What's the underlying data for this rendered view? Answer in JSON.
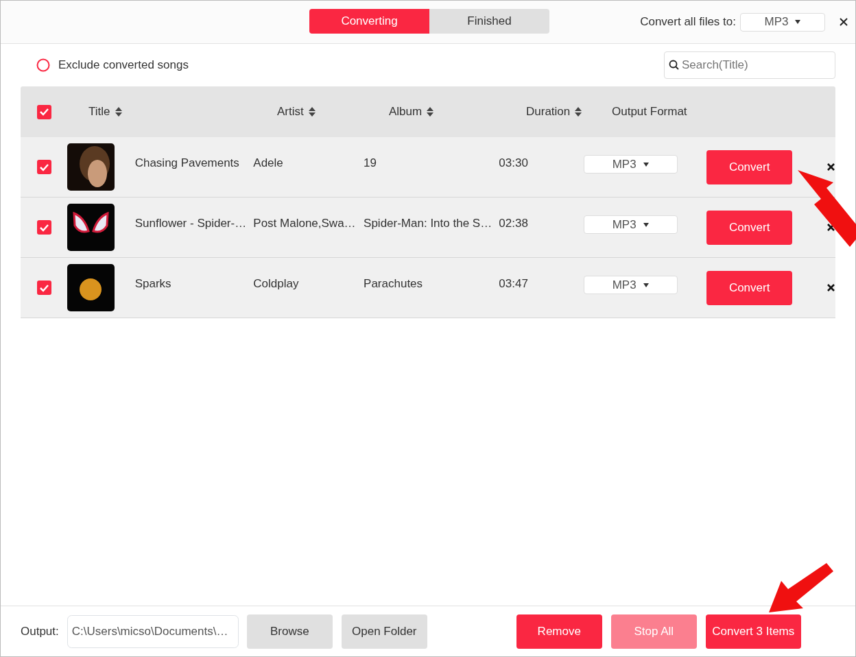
{
  "tabs": [
    {
      "label": "Converting",
      "selected": true
    },
    {
      "label": "Finished",
      "selected": false
    }
  ],
  "convert_all": {
    "label": "Convert all files to:",
    "value": "MP3"
  },
  "exclude_converted": {
    "label": "Exclude converted songs",
    "checked": false
  },
  "search": {
    "placeholder": "Search(Title)"
  },
  "table": {
    "select_all": true,
    "columns": [
      {
        "label": "Title",
        "sortable": true
      },
      {
        "label": "Artist",
        "sortable": true
      },
      {
        "label": "Album",
        "sortable": true
      },
      {
        "label": "Duration",
        "sortable": true
      },
      {
        "label": "Output Format",
        "sortable": false
      }
    ],
    "rows": [
      {
        "checked": true,
        "title": "Chasing Pavements",
        "artist": "Adele",
        "album": "19",
        "duration": "03:30",
        "format": "MP3",
        "action": "Convert"
      },
      {
        "checked": true,
        "title": "Sunflower - Spider-…",
        "artist": "Post Malone,Swa…",
        "album": "Spider-Man: Into the S…",
        "duration": "02:38",
        "format": "MP3",
        "action": "Convert"
      },
      {
        "checked": true,
        "title": "Sparks",
        "artist": "Coldplay",
        "album": "Parachutes",
        "duration": "03:47",
        "format": "MP3",
        "action": "Convert"
      }
    ]
  },
  "footer": {
    "output_label": "Output:",
    "output_path": "C:\\Users\\micso\\Documents\\…",
    "buttons": [
      {
        "label": "Browse",
        "kind": "secondary",
        "disabled": false
      },
      {
        "label": "Open Folder",
        "kind": "secondary",
        "disabled": false
      },
      {
        "label": "Remove",
        "kind": "primary",
        "disabled": false
      },
      {
        "label": "Stop All",
        "kind": "primary",
        "disabled": true
      },
      {
        "label": "Convert 3 Items",
        "kind": "primary",
        "disabled": false
      }
    ]
  }
}
